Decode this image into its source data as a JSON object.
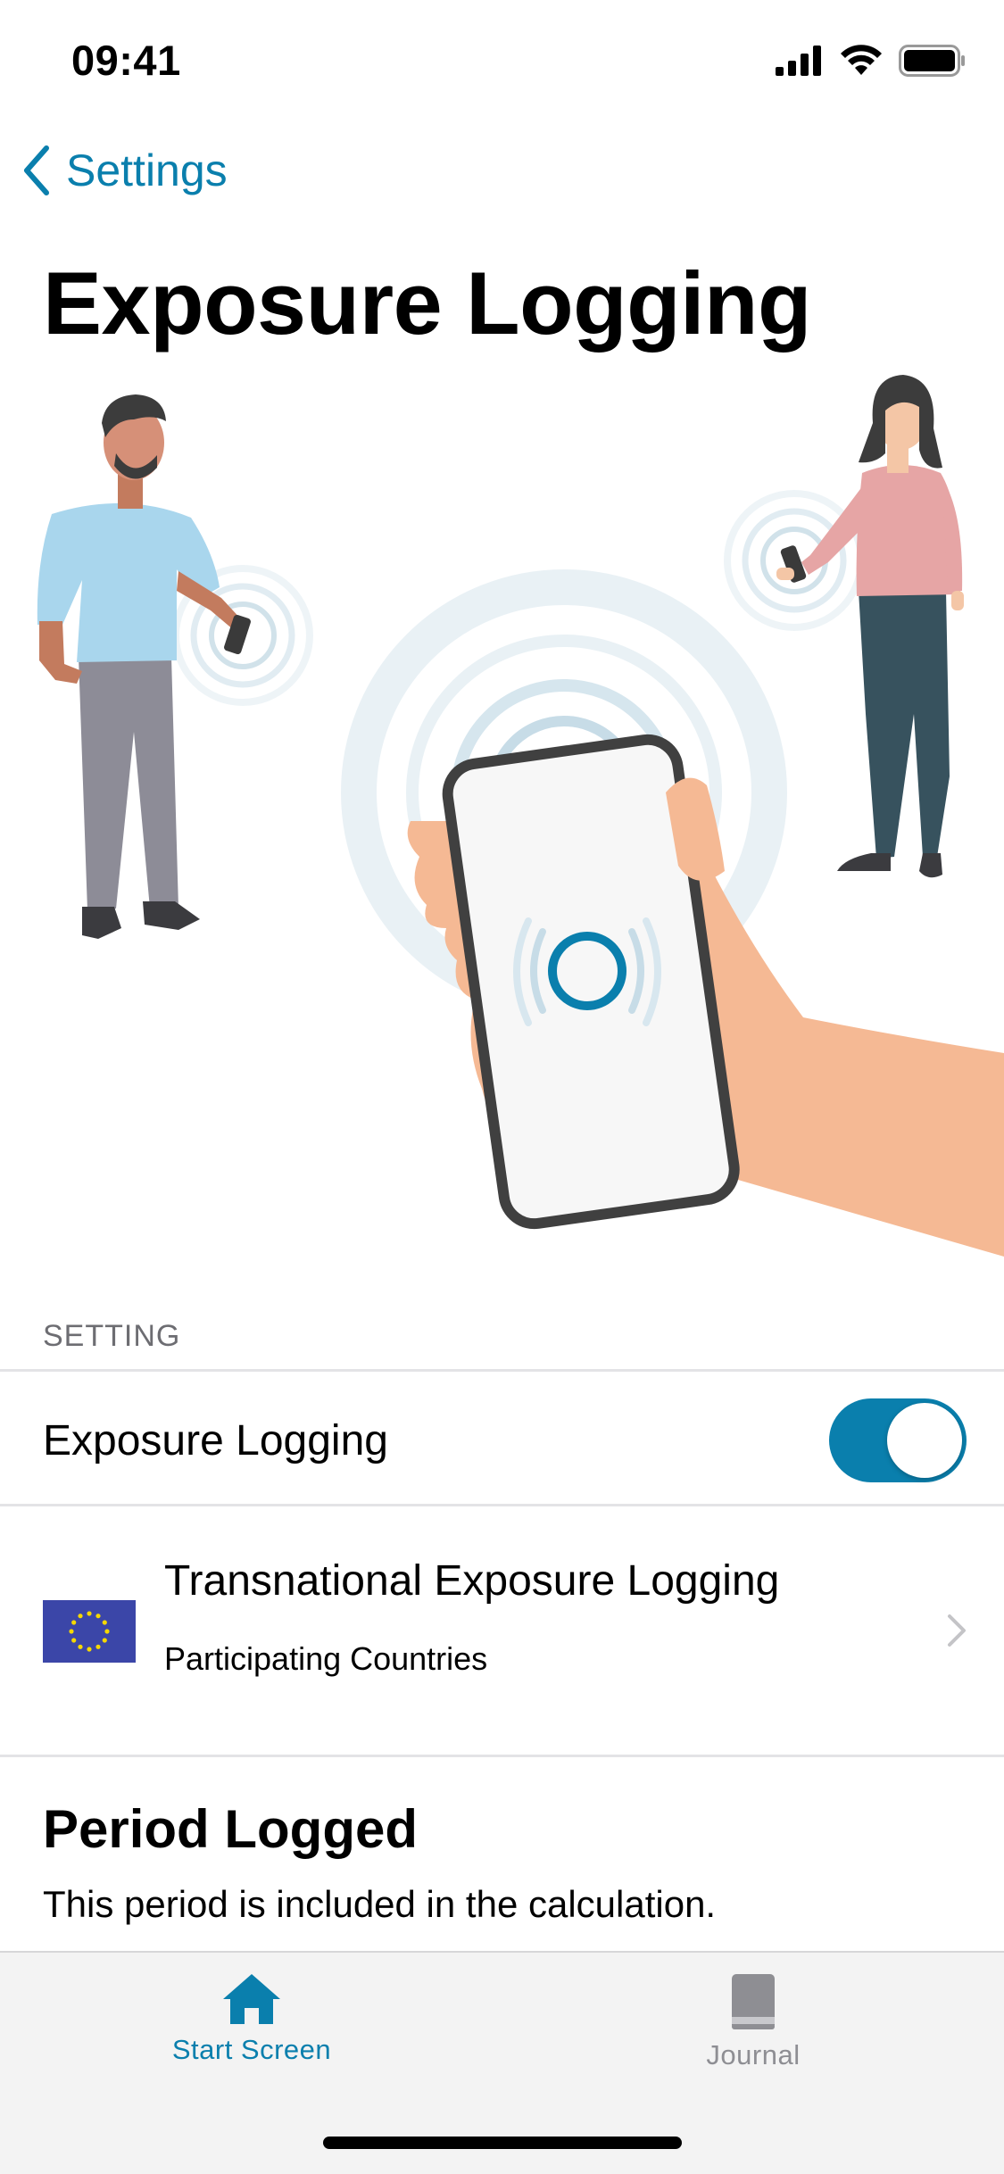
{
  "status_bar": {
    "time": "09:41"
  },
  "nav": {
    "back_label": "Settings",
    "title": "Exposure Logging"
  },
  "settings": {
    "section_header": "SETTING",
    "exposure_logging": {
      "label": "Exposure Logging",
      "enabled": true
    },
    "transnational": {
      "title": "Transnational Exposure Logging",
      "subtitle": "Participating Countries"
    }
  },
  "period": {
    "title": "Period Logged",
    "text": "This period is included in the calculation."
  },
  "tab_bar": {
    "tabs": [
      {
        "label": "Start Screen",
        "icon": "home-icon",
        "selected": true
      },
      {
        "label": "Journal",
        "icon": "book-icon",
        "selected": false
      }
    ]
  },
  "colors": {
    "accent": "#0a7fad",
    "toggle_on": "#0a7fad",
    "tab_inactive": "#8e8e93",
    "eu_blue": "#3b46a8",
    "eu_star": "#f5d800"
  }
}
